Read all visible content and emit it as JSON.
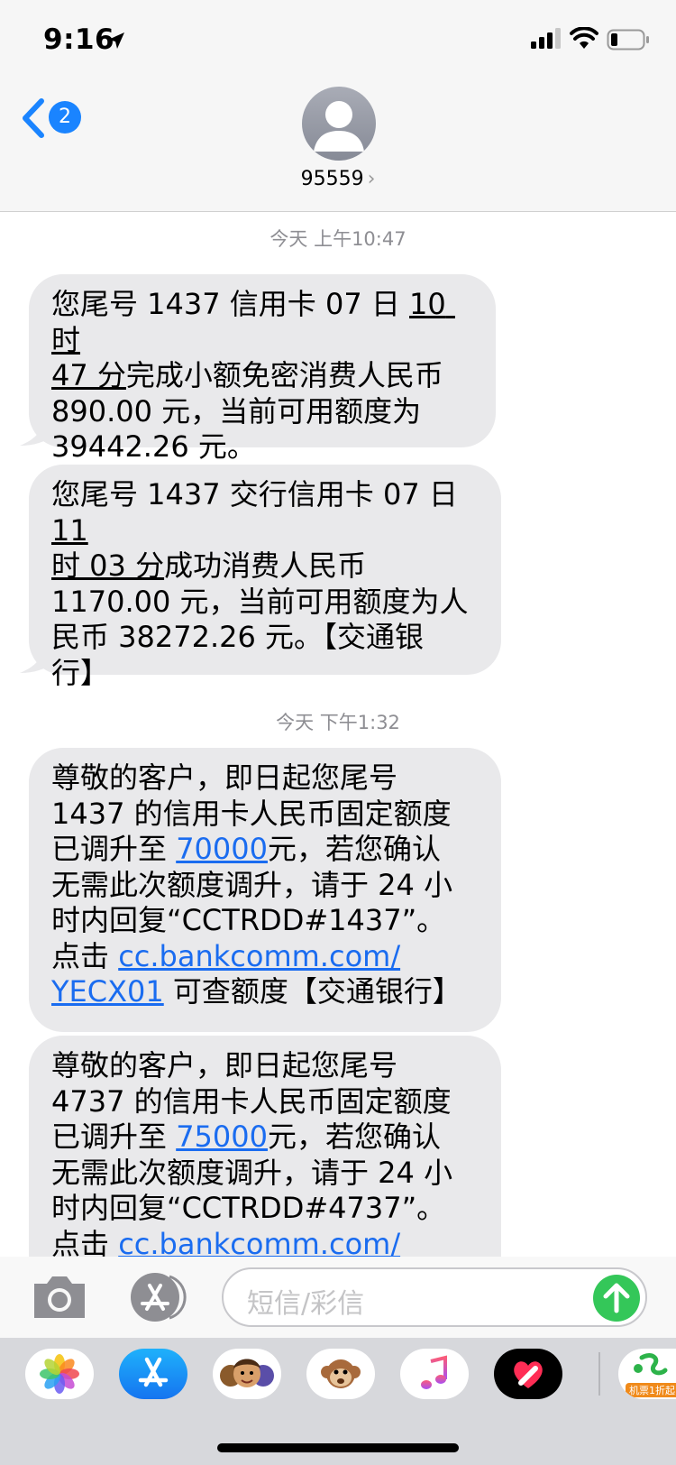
{
  "status_bar": {
    "time": "9:16"
  },
  "header": {
    "back_count": "2",
    "contact_name": "95559",
    "contact_chevron": "›"
  },
  "messages": {
    "group1_time": "今天 上午10:47",
    "m1": {
      "a": "您尾号 1437 信用卡 07 日 ",
      "u": "10 时\n47 分",
      "b": "完成小额免密消费人民币\n890.00 元，当前可用额度为\n39442.26 元。"
    },
    "m2": {
      "a": "您尾号 1437 交行信用卡 07 日 ",
      "u": "11\n时 03 分",
      "b": "成功消费人民币\n1170.00 元，当前可用额度为人\n民币 38272.26 元。【交通银\n行】"
    },
    "group2_time": "今天 下午1:32",
    "m3": {
      "a": "尊敬的客户，即日起您尾号\n1437 的信用卡人民币固定额度\n已调升至 ",
      "amount": "70000",
      "b": "元，若您确认\n无需此次额度调升，请于 24 小\n时内回复“CCTRDD#1437”。\n点击 ",
      "link": "cc.bankcomm.com/\nYECX01",
      "c": " 可查额度【交通银行】"
    },
    "m4": {
      "a": "尊敬的客户，即日起您尾号\n4737 的信用卡人民币固定额度\n已调升至 ",
      "amount": "75000",
      "b": "元，若您确认\n无需此次额度调升，请于 24 小\n时内回复“CCTRDD#4737”。\n点击 ",
      "link": "cc.bankcomm.com/"
    }
  },
  "input": {
    "placeholder": "短信/彩信"
  },
  "app_drawer": {
    "apps": [
      "photos-icon",
      "app-store-icon",
      "memoji-icon",
      "animoji-monkey-icon",
      "music-icon",
      "digital-touch-icon",
      "partial-app-icon"
    ],
    "partial_app_text": "机票1折起"
  },
  "colors": {
    "accent": "#1a84ff",
    "link": "#1a6cf0",
    "bubble": "#e9e9eb",
    "send": "#34c759"
  }
}
